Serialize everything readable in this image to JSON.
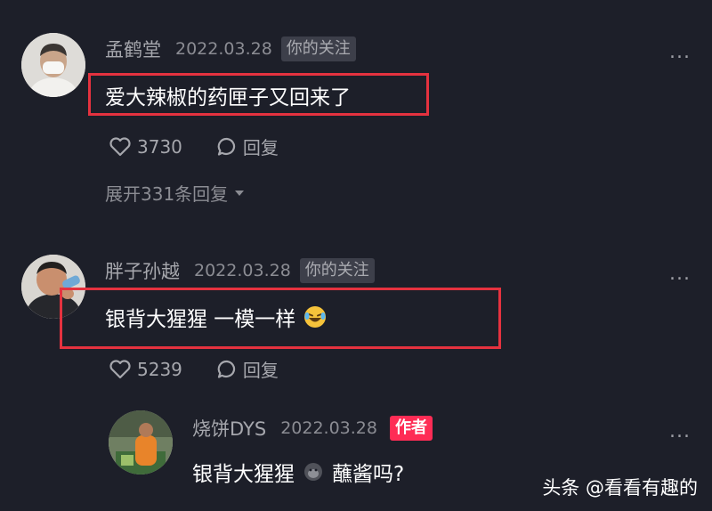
{
  "comments": [
    {
      "username": "孟鹤堂",
      "date": "2022.03.28",
      "tag": "你的关注",
      "text": "爱大辣椒的药匣子又回来了",
      "likes": "3730",
      "reply_label": "回复",
      "expand_label": "展开331条回复"
    },
    {
      "username": "胖子孙越",
      "date": "2022.03.28",
      "tag": "你的关注",
      "text": "银背大猩猩 一模一样",
      "likes": "5239",
      "reply_label": "回复"
    }
  ],
  "reply": {
    "username": "烧饼DYS",
    "date": "2022.03.28",
    "tag": "作者",
    "text_part1": "银背大猩猩",
    "text_part2": "蘸酱吗?"
  },
  "more_label": "...",
  "watermark": {
    "brand": "头条",
    "account": "@看看有趣的"
  },
  "colors": {
    "background": "#1d1f29",
    "highlight_box": "#e5323f",
    "author_tag": "#fe2c55"
  }
}
